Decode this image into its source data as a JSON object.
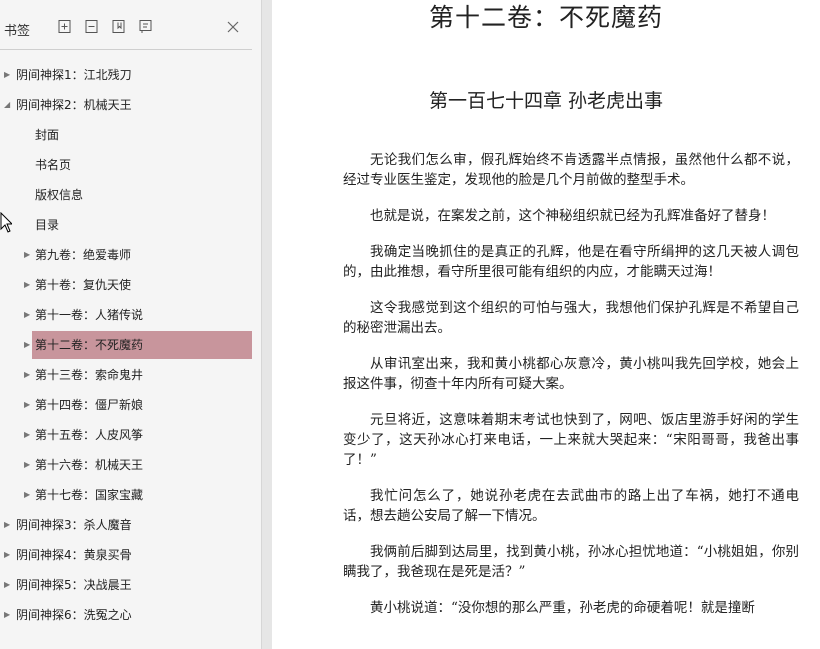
{
  "sidebar": {
    "title": "书签",
    "close_glyph": "×",
    "tools": [
      "expand-all-icon",
      "collapse-all-icon",
      "bookmark-add-icon",
      "bookmark-flag-icon"
    ],
    "items": [
      {
        "label": "阴间神探1：江北残刀",
        "level": 0,
        "state": "collapsed"
      },
      {
        "label": "阴间神探2：机械天王",
        "level": 0,
        "state": "expanded"
      },
      {
        "label": "封面",
        "level": 1,
        "state": "leaf"
      },
      {
        "label": "书名页",
        "level": 1,
        "state": "leaf"
      },
      {
        "label": "版权信息",
        "level": 1,
        "state": "leaf"
      },
      {
        "label": "目录",
        "level": 1,
        "state": "leaf"
      },
      {
        "label": "第九卷：绝爱毒师",
        "level": 1,
        "state": "collapsed"
      },
      {
        "label": "第十卷：复仇天使",
        "level": 1,
        "state": "collapsed"
      },
      {
        "label": "第十一卷：人猪传说",
        "level": 1,
        "state": "collapsed"
      },
      {
        "label": "第十二卷：不死魔药",
        "level": 1,
        "state": "collapsed",
        "selected": true
      },
      {
        "label": "第十三卷：索命鬼井",
        "level": 1,
        "state": "collapsed"
      },
      {
        "label": "第十四卷：僵尸新娘",
        "level": 1,
        "state": "collapsed"
      },
      {
        "label": "第十五卷：人皮风筝",
        "level": 1,
        "state": "collapsed"
      },
      {
        "label": "第十六卷：机械天王",
        "level": 1,
        "state": "collapsed"
      },
      {
        "label": "第十七卷：国家宝藏",
        "level": 1,
        "state": "collapsed"
      },
      {
        "label": "阴间神探3：杀人魔音",
        "level": 0,
        "state": "collapsed"
      },
      {
        "label": "阴间神探4：黄泉买骨",
        "level": 0,
        "state": "collapsed"
      },
      {
        "label": "阴间神探5：决战晨王",
        "level": 0,
        "state": "collapsed"
      },
      {
        "label": "阴间神探6：洗冤之心",
        "level": 0,
        "state": "collapsed"
      }
    ],
    "highlight_color": "#c8959c"
  },
  "document": {
    "volume_title": "第十二卷：不死魔药",
    "chapter_title": "第一百七十四章 孙老虎出事",
    "paragraphs": [
      "无论我们怎么审，假孔辉始终不肯透露半点情报，虽然他什么都不说，经过专业医生鉴定，发现他的脸是几个月前做的整型手术。",
      "也就是说，在案发之前，这个神秘组织就已经为孔辉准备好了替身！",
      "我确定当晚抓住的是真正的孔辉，他是在看守所绢押的这几天被人调包的，由此推想，看守所里很可能有组织的内应，才能瞒天过海！",
      "这令我感觉到这个组织的可怕与强大，我想他们保护孔辉是不希望自己的秘密泄漏出去。",
      "从审讯室出来，我和黄小桃都心灰意冷，黄小桃叫我先回学校，她会上报这件事，彻查十年内所有可疑大案。",
      "元旦将近，这意味着期末考试也快到了，网吧、饭店里游手好闲的学生变少了，这天孙冰心打来电话，一上来就大哭起来：“宋阳哥哥，我爸出事了！”",
      "我忙问怎么了，她说孙老虎在去武曲市的路上出了车祸，她打不通电话，想去趟公安局了解一下情况。",
      "我俩前后脚到达局里，找到黄小桃，孙冰心担忧地道：“小桃姐姐，你别瞒我了，我爸现在是死是活？”",
      "黄小桃说道：“没你想的那么严重，孙老虎的命硬着呢！就是撞断"
    ]
  }
}
